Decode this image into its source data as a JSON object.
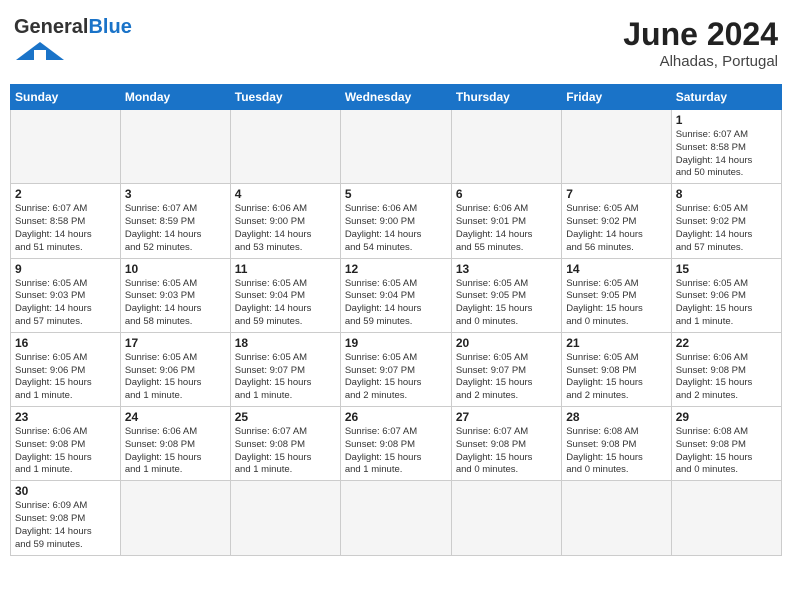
{
  "header": {
    "logo_general": "General",
    "logo_blue": "Blue",
    "month_year": "June 2024",
    "location": "Alhadas, Portugal"
  },
  "weekdays": [
    "Sunday",
    "Monday",
    "Tuesday",
    "Wednesday",
    "Thursday",
    "Friday",
    "Saturday"
  ],
  "weeks": [
    [
      {
        "day": "",
        "info": ""
      },
      {
        "day": "",
        "info": ""
      },
      {
        "day": "",
        "info": ""
      },
      {
        "day": "",
        "info": ""
      },
      {
        "day": "",
        "info": ""
      },
      {
        "day": "",
        "info": ""
      },
      {
        "day": "1",
        "info": "Sunrise: 6:07 AM\nSunset: 8:58 PM\nDaylight: 14 hours\nand 50 minutes."
      }
    ],
    [
      {
        "day": "2",
        "info": "Sunrise: 6:07 AM\nSunset: 8:58 PM\nDaylight: 14 hours\nand 51 minutes."
      },
      {
        "day": "3",
        "info": "Sunrise: 6:07 AM\nSunset: 8:59 PM\nDaylight: 14 hours\nand 52 minutes."
      },
      {
        "day": "4",
        "info": "Sunrise: 6:06 AM\nSunset: 9:00 PM\nDaylight: 14 hours\nand 53 minutes."
      },
      {
        "day": "5",
        "info": "Sunrise: 6:06 AM\nSunset: 9:00 PM\nDaylight: 14 hours\nand 54 minutes."
      },
      {
        "day": "6",
        "info": "Sunrise: 6:06 AM\nSunset: 9:01 PM\nDaylight: 14 hours\nand 55 minutes."
      },
      {
        "day": "7",
        "info": "Sunrise: 6:05 AM\nSunset: 9:02 PM\nDaylight: 14 hours\nand 56 minutes."
      },
      {
        "day": "8",
        "info": "Sunrise: 6:05 AM\nSunset: 9:02 PM\nDaylight: 14 hours\nand 57 minutes."
      }
    ],
    [
      {
        "day": "9",
        "info": "Sunrise: 6:05 AM\nSunset: 9:03 PM\nDaylight: 14 hours\nand 57 minutes."
      },
      {
        "day": "10",
        "info": "Sunrise: 6:05 AM\nSunset: 9:03 PM\nDaylight: 14 hours\nand 58 minutes."
      },
      {
        "day": "11",
        "info": "Sunrise: 6:05 AM\nSunset: 9:04 PM\nDaylight: 14 hours\nand 59 minutes."
      },
      {
        "day": "12",
        "info": "Sunrise: 6:05 AM\nSunset: 9:04 PM\nDaylight: 14 hours\nand 59 minutes."
      },
      {
        "day": "13",
        "info": "Sunrise: 6:05 AM\nSunset: 9:05 PM\nDaylight: 15 hours\nand 0 minutes."
      },
      {
        "day": "14",
        "info": "Sunrise: 6:05 AM\nSunset: 9:05 PM\nDaylight: 15 hours\nand 0 minutes."
      },
      {
        "day": "15",
        "info": "Sunrise: 6:05 AM\nSunset: 9:06 PM\nDaylight: 15 hours\nand 1 minute."
      }
    ],
    [
      {
        "day": "16",
        "info": "Sunrise: 6:05 AM\nSunset: 9:06 PM\nDaylight: 15 hours\nand 1 minute."
      },
      {
        "day": "17",
        "info": "Sunrise: 6:05 AM\nSunset: 9:06 PM\nDaylight: 15 hours\nand 1 minute."
      },
      {
        "day": "18",
        "info": "Sunrise: 6:05 AM\nSunset: 9:07 PM\nDaylight: 15 hours\nand 1 minute."
      },
      {
        "day": "19",
        "info": "Sunrise: 6:05 AM\nSunset: 9:07 PM\nDaylight: 15 hours\nand 2 minutes."
      },
      {
        "day": "20",
        "info": "Sunrise: 6:05 AM\nSunset: 9:07 PM\nDaylight: 15 hours\nand 2 minutes."
      },
      {
        "day": "21",
        "info": "Sunrise: 6:05 AM\nSunset: 9:08 PM\nDaylight: 15 hours\nand 2 minutes."
      },
      {
        "day": "22",
        "info": "Sunrise: 6:06 AM\nSunset: 9:08 PM\nDaylight: 15 hours\nand 2 minutes."
      }
    ],
    [
      {
        "day": "23",
        "info": "Sunrise: 6:06 AM\nSunset: 9:08 PM\nDaylight: 15 hours\nand 1 minute."
      },
      {
        "day": "24",
        "info": "Sunrise: 6:06 AM\nSunset: 9:08 PM\nDaylight: 15 hours\nand 1 minute."
      },
      {
        "day": "25",
        "info": "Sunrise: 6:07 AM\nSunset: 9:08 PM\nDaylight: 15 hours\nand 1 minute."
      },
      {
        "day": "26",
        "info": "Sunrise: 6:07 AM\nSunset: 9:08 PM\nDaylight: 15 hours\nand 1 minute."
      },
      {
        "day": "27",
        "info": "Sunrise: 6:07 AM\nSunset: 9:08 PM\nDaylight: 15 hours\nand 0 minutes."
      },
      {
        "day": "28",
        "info": "Sunrise: 6:08 AM\nSunset: 9:08 PM\nDaylight: 15 hours\nand 0 minutes."
      },
      {
        "day": "29",
        "info": "Sunrise: 6:08 AM\nSunset: 9:08 PM\nDaylight: 15 hours\nand 0 minutes."
      }
    ],
    [
      {
        "day": "30",
        "info": "Sunrise: 6:09 AM\nSunset: 9:08 PM\nDaylight: 14 hours\nand 59 minutes."
      },
      {
        "day": "",
        "info": ""
      },
      {
        "day": "",
        "info": ""
      },
      {
        "day": "",
        "info": ""
      },
      {
        "day": "",
        "info": ""
      },
      {
        "day": "",
        "info": ""
      },
      {
        "day": "",
        "info": ""
      }
    ]
  ]
}
